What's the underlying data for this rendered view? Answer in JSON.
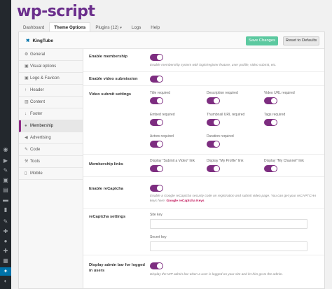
{
  "brand": {
    "logo_text": "wp-script"
  },
  "tabs": [
    {
      "label": "Dashboard"
    },
    {
      "label": "Theme Options"
    },
    {
      "label": "Plugins (12)"
    },
    {
      "label": "Logs"
    },
    {
      "label": "Help"
    }
  ],
  "header": {
    "site_name": "KingTube",
    "save_label": "Save Changes",
    "reset_label": "Reset to Defaults"
  },
  "nav": [
    {
      "label": "General",
      "icon": "gear-icon"
    },
    {
      "label": "Visual options",
      "icon": "image-icon"
    },
    {
      "label": "Logo & Favicon",
      "icon": "image-icon"
    },
    {
      "label": "Header",
      "icon": "arrow-up-icon"
    },
    {
      "label": "Content",
      "icon": "columns-icon"
    },
    {
      "label": "Footer",
      "icon": "arrow-down-icon"
    },
    {
      "label": "Membership",
      "icon": "user-icon"
    },
    {
      "label": "Advertising",
      "icon": "bullhorn-icon"
    },
    {
      "label": "Code",
      "icon": "code-icon"
    },
    {
      "label": "Tools",
      "icon": "wrench-icon"
    },
    {
      "label": "Mobile",
      "icon": "mobile-icon"
    }
  ],
  "settings": {
    "enable_membership": {
      "label": "Enable membership",
      "help": "Enable membership system with login/register feature, user profile, video submit, etc.",
      "enabled": true
    },
    "enable_video_submission": {
      "label": "Enable video submission",
      "enabled": true
    },
    "video_submit_settings": {
      "label": "Video submit settings",
      "items": [
        {
          "label": "Title required",
          "enabled": true
        },
        {
          "label": "Description required",
          "enabled": true
        },
        {
          "label": "Video URL required",
          "enabled": true
        },
        {
          "label": "Embed required",
          "enabled": true
        },
        {
          "label": "Thumbnail URL required",
          "enabled": true
        },
        {
          "label": "Tags required",
          "enabled": true
        },
        {
          "label": "Actors required",
          "enabled": true
        },
        {
          "label": "Duration required",
          "enabled": true
        }
      ]
    },
    "membership_links": {
      "label": "Membership links",
      "items": [
        {
          "label": "Display \"Submit a Video\" link",
          "enabled": true
        },
        {
          "label": "Display \"My Profile\" link",
          "enabled": true
        },
        {
          "label": "Display \"My Channel\" link",
          "enabled": true
        }
      ]
    },
    "enable_recaptcha": {
      "label": "Enable reCaptcha",
      "help": "Enable a Google reCaptcha security code on registration and submit video page. You can get your reCAPTCHA keys here:",
      "link": "Google reCaptcha Keys",
      "enabled": true
    },
    "recaptcha_settings": {
      "label": "reCaptcha settings",
      "site_key_label": "Site key",
      "site_key_value": "",
      "secret_key_label": "Secret key",
      "secret_key_value": ""
    },
    "display_admin_bar": {
      "label": "Display admin bar for logged in users",
      "help": "Display the WP admin bar when a user is logged on your site and let him go to the admin.",
      "enabled": true
    }
  },
  "colors": {
    "brand": "#6b2f8c",
    "toggle_on": "#7d2d80",
    "save_button": "#5cc9a0",
    "active_nav_border": "#8e2a86",
    "wp_sidebar": "#23282d",
    "wp_active": "#0073aa"
  }
}
